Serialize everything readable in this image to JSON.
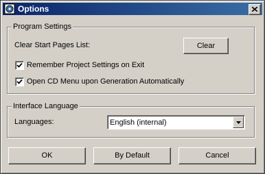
{
  "window": {
    "title": "Options",
    "icon": "app-icon"
  },
  "program_settings": {
    "group_label": "Program Settings",
    "clear_label": "Clear Start Pages List:",
    "clear_button": "Clear",
    "remember_label": "Remember Project Settings on Exit",
    "remember_checked": true,
    "open_cd_label": "Open CD Menu upon Generation Automatically",
    "open_cd_checked": true
  },
  "interface_language": {
    "group_label": "Interface Language",
    "languages_label": "Languages:",
    "selected_language": "English (internal)"
  },
  "footer": {
    "ok": "OK",
    "by_default": "By Default",
    "cancel": "Cancel"
  },
  "colors": {
    "titlebar_start": "#0a246a",
    "titlebar_end": "#3a6ea5",
    "face": "#d4d0c8"
  }
}
